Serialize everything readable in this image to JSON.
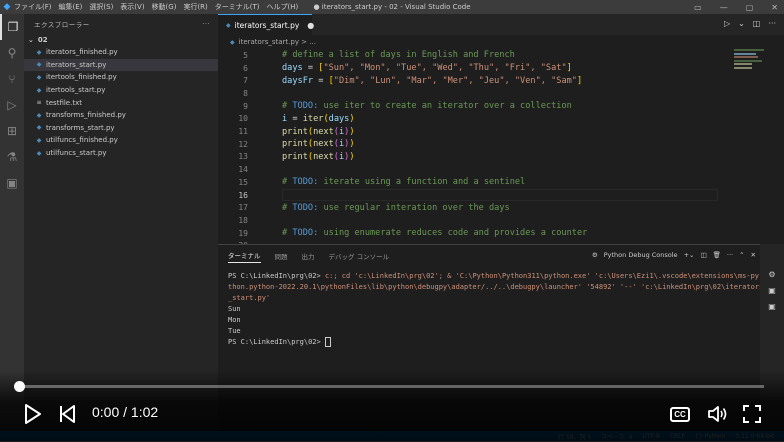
{
  "titlebar": {
    "menus": [
      "ファイル(F)",
      "編集(E)",
      "選択(S)",
      "表示(V)",
      "移動(G)",
      "実行(R)",
      "ターミナル(T)",
      "ヘルプ(H)"
    ],
    "title": "● iterators_start.py - 02 - Visual Studio Code"
  },
  "sidebar": {
    "header": "エクスプローラー",
    "folder": "02",
    "files": [
      {
        "name": "iterators_finished.py",
        "type": "py"
      },
      {
        "name": "iterators_start.py",
        "type": "py",
        "selected": true
      },
      {
        "name": "itertools_finished.py",
        "type": "py"
      },
      {
        "name": "itertools_start.py",
        "type": "py"
      },
      {
        "name": "testfile.txt",
        "type": "txt"
      },
      {
        "name": "transforms_finished.py",
        "type": "py"
      },
      {
        "name": "transforms_start.py",
        "type": "py"
      },
      {
        "name": "utilfuncs_finished.py",
        "type": "py"
      },
      {
        "name": "utilfuncs_start.py",
        "type": "py"
      }
    ]
  },
  "tab": {
    "label": "iterators_start.py",
    "modified_dot": "●"
  },
  "breadcrumb": "iterators_start.py > ...",
  "editor": {
    "line_numbers": [
      "5",
      "6",
      "7",
      "8",
      "9",
      "10",
      "11",
      "12",
      "13",
      "14",
      "15",
      "16",
      "17",
      "18",
      "19",
      "20"
    ],
    "current_line": "16",
    "lines": {
      "l5": "# define a list of days in English and French",
      "l6_var": "days",
      "l6_list": "\"Sun\", \"Mon\", \"Tue\", \"Wed\", \"Thu\", \"Fri\", \"Sat\"",
      "l7_var": "daysFr",
      "l7_list": "\"Dim\", \"Lun\", \"Mar\", \"Mer\", \"Jeu\", \"Ven\", \"Sam\"",
      "l9": "use iter to create an iterator over a collection",
      "l10_var": "i",
      "l10_fn": "iter",
      "l10_arg": "days",
      "print_fn": "print",
      "next_fn": "next",
      "l15": "iterate using a function and a sentinel",
      "l17": "use regular interation over the days",
      "l19": "using enumerate reduces code and provides a counter",
      "todo_tag": "TODO:",
      "hash": "#"
    }
  },
  "panel": {
    "tabs": [
      "ターミナル",
      "問題",
      "出力",
      "デバッグ コンソール"
    ],
    "debug_console_label": "Python Debug Console",
    "terminal": {
      "prompt1": "PS C:\\LinkedIn\\prg\\02>",
      "cmd_text": "c:; cd 'c:\\LinkedIn\\prg\\02'; & 'C:\\Python\\Python311\\python.exe' 'c:\\Users\\Ezi1\\.vscode\\extensions\\ms-py",
      "cmd_text2": "thon.python-2022.20.1\\pythonFiles\\lib\\python\\debugpy\\adapter/../..\\debugpy\\launcher' '54892' '--' 'c:\\LinkedIn\\prg\\02\\iterators",
      "cmd_text3": "_start.py'",
      "out": [
        "Sun",
        "Mon",
        "Tue"
      ],
      "prompt2": "PS C:\\LinkedIn\\prg\\02>"
    }
  },
  "statusbar": {
    "items": [
      "行 16、列 5",
      "スペース: 4",
      "UTF-8",
      "CRLF",
      "{} Python",
      "3.11.0 64-bit"
    ]
  },
  "video": {
    "time": "0:00 / 1:02",
    "progress_fraction": 0.0,
    "cc_label": "CC"
  }
}
